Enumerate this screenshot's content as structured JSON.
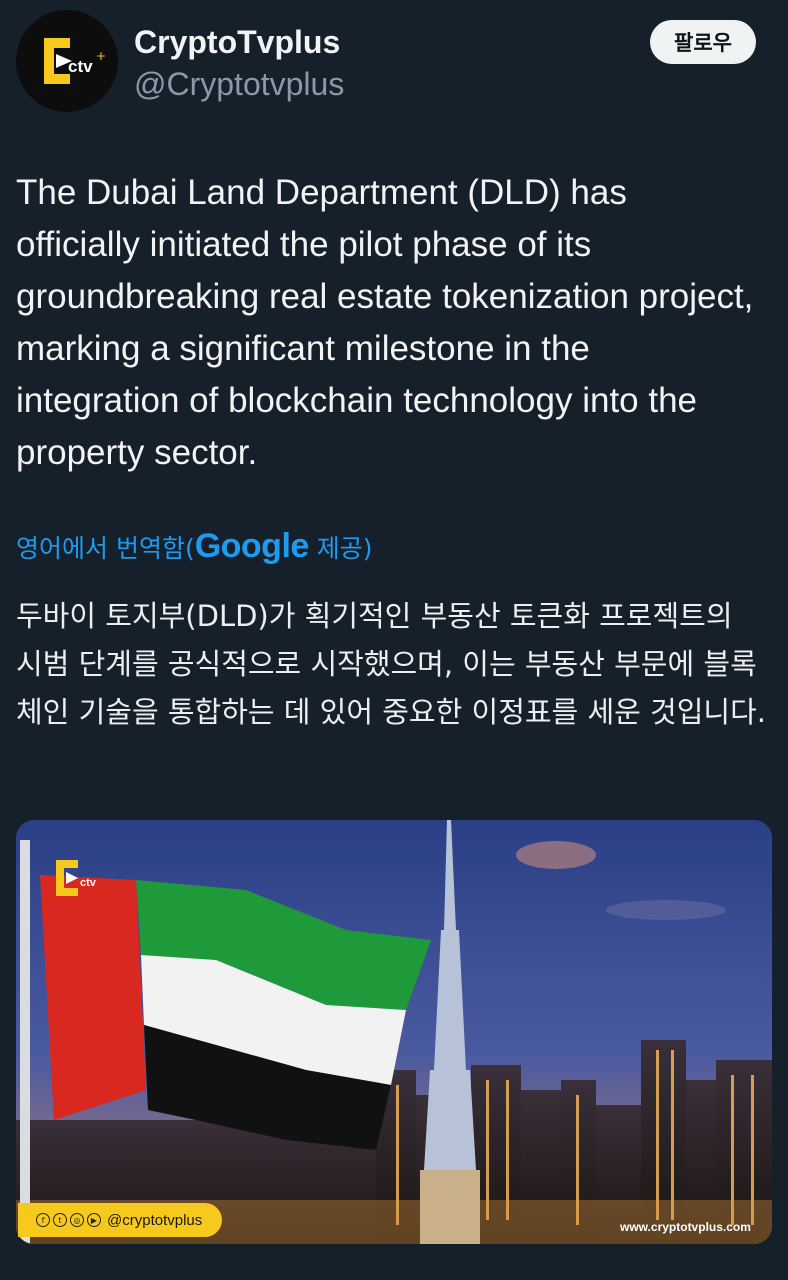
{
  "author": {
    "display_name": "CryptoTvplus",
    "handle": "@Cryptotvplus",
    "avatar_logo_text": "ctv"
  },
  "follow_button": "팔로우",
  "tweet": {
    "text": "The Dubai Land Department (DLD) has officially initiated the pilot phase of its groundbreaking real estate tokenization project, marking a significant milestone in the integration of blockchain technology into the property sector."
  },
  "translation": {
    "prefix": "영어에서 번역함(",
    "provider": "Google",
    "suffix": " 제공)",
    "text": "두바이 토지부(DLD)가 획기적인 부동산 토큰화 프로젝트의 시범 단계를 공식적으로 시작했으며, 이는 부동산 부문에 블록체인 기술을 통합하는 데 있어 중요한 이정표를 세운 것입니다."
  },
  "media": {
    "logo_text": "ctv",
    "social_handle": "@cryptotvplus",
    "social_icons": [
      "facebook-icon",
      "twitter-icon",
      "instagram-icon",
      "youtube-icon"
    ],
    "site_url": "www.cryptotvplus.com"
  },
  "colors": {
    "background": "#16202b",
    "link": "#1d9bf0",
    "brand_yellow": "#f6c91c",
    "flag_red": "#d9281f",
    "flag_green": "#1f9a3a"
  }
}
